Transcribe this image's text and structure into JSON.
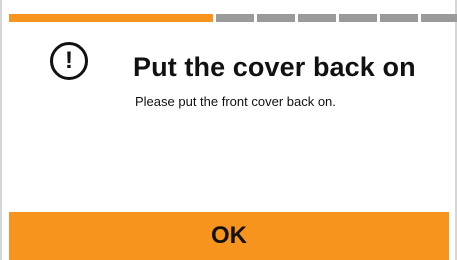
{
  "progress": {
    "completed_fraction": 0.45,
    "segments_done": 1,
    "segments_remaining": 6,
    "colors": {
      "done": "#f7941e",
      "remaining": "#9a9a9a"
    }
  },
  "dialog": {
    "icon": "exclamation-circle-icon",
    "icon_glyph": "!",
    "title": "Put the cover back on",
    "message": "Please put the front cover back on."
  },
  "actions": {
    "ok_label": "OK",
    "accent_color": "#f7941e"
  }
}
